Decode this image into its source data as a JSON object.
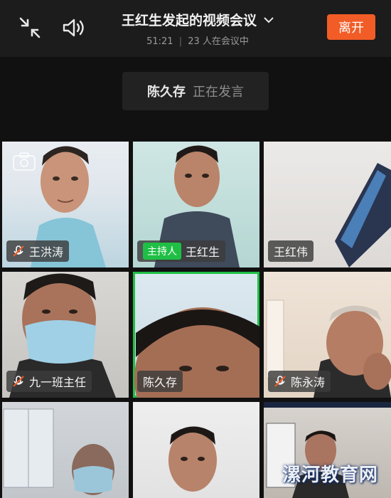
{
  "header": {
    "title": "王红生发起的视频会议",
    "duration": "51:21",
    "participants": "23 人在会议中",
    "leave_label": "离开",
    "icons": [
      "collapse-icon",
      "speaker-icon",
      "chevron-down-icon"
    ]
  },
  "speaking": {
    "name": "陈久存",
    "status": "正在发言"
  },
  "participants": [
    {
      "name": "王洪涛",
      "muted": true,
      "camera_off_icon": true
    },
    {
      "name": "王红生",
      "host_label": "主持人"
    },
    {
      "name": "王红伟"
    },
    {
      "name": "九一班主任",
      "muted": true
    },
    {
      "name": "陈久存",
      "active_speaker": true
    },
    {
      "name": "陈永涛",
      "muted": true
    },
    {
      "name": ""
    },
    {
      "name": ""
    },
    {
      "name": ""
    }
  ],
  "watermark": "漯河教育网",
  "colors": {
    "accent_orange": "#f25c26",
    "active_green": "#1fbf45",
    "topbar_bg": "#1c1c1c"
  }
}
